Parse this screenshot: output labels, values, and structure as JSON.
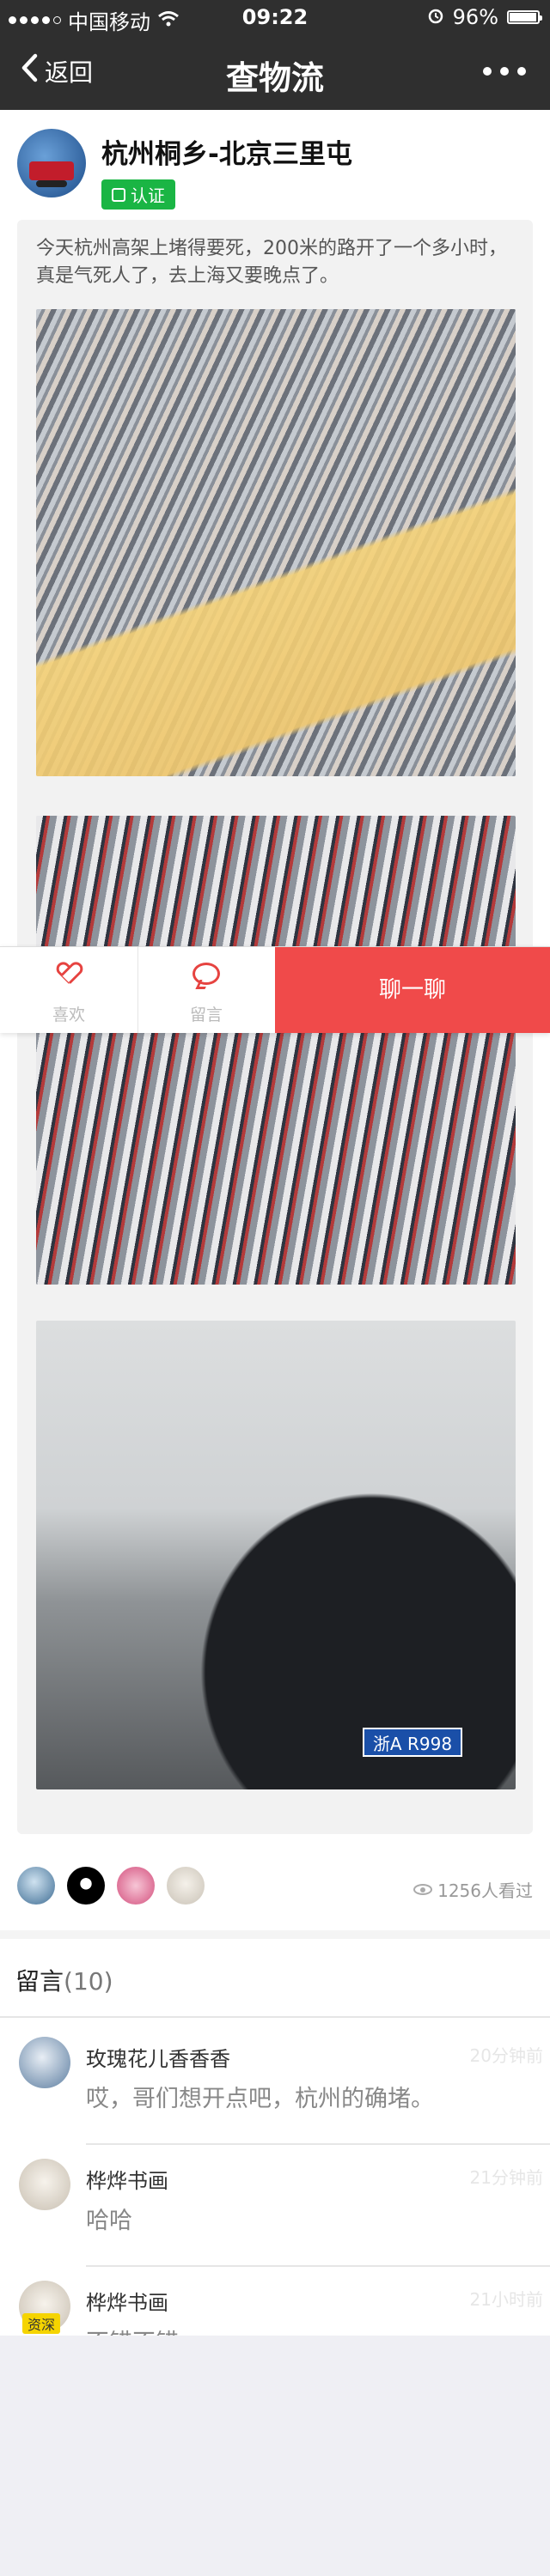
{
  "status_bar": {
    "carrier": "中国移动",
    "time": "09:22",
    "battery": "96%",
    "battery_level": 0.96
  },
  "nav": {
    "back_label": "返回",
    "title": "查物流"
  },
  "author": {
    "name": "杭州桐乡-北京三里屯",
    "cert_label": "认证"
  },
  "post": {
    "text": "今天杭州高架上堵得要死，200米的路开了一个多小时，真是气死人了，去上海又要晚点了。",
    "plate": "浙A R998"
  },
  "viewers": {
    "count_text": "1256人看过"
  },
  "actions": {
    "like_label": "喜欢",
    "comment_label": "留言",
    "chat_label": "聊一聊"
  },
  "comments": {
    "title": "留言",
    "count": "(10)",
    "items": [
      {
        "name": "玫瑰花儿香香香",
        "time": "20分钟前",
        "text": "哎，哥们想开点吧，杭州的确堵。"
      },
      {
        "name": "桦烨书画",
        "time": "21分钟前",
        "text": "哈哈"
      },
      {
        "name": "桦烨书画",
        "time": "21小时前",
        "text": "不错不错",
        "badge": "资深"
      }
    ]
  }
}
